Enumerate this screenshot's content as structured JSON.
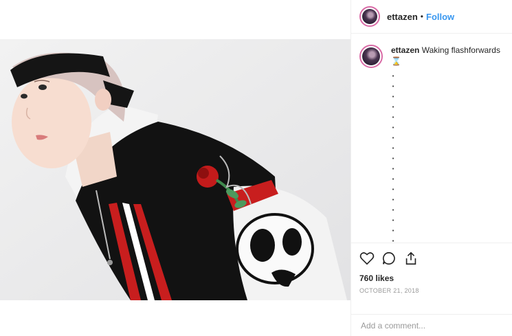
{
  "post": {
    "image_alt": "Person wearing black headband and bomber jacket with rose and panda patches"
  },
  "header": {
    "username": "ettazen",
    "separator": "•",
    "follow_label": "Follow"
  },
  "caption": {
    "username": "ettazen",
    "text": "Waking flashforwards",
    "emoji": "⌛"
  },
  "actions": {
    "like_icon": "heart-icon",
    "comment_icon": "comment-icon",
    "share_icon": "share-icon"
  },
  "stats": {
    "likes": "760 likes",
    "date": "OCTOBER 21, 2018"
  },
  "comment_box": {
    "placeholder": "Add a comment..."
  },
  "colors": {
    "follow_blue": "#3897f0",
    "border": "#efefef",
    "muted_text": "#999999"
  }
}
